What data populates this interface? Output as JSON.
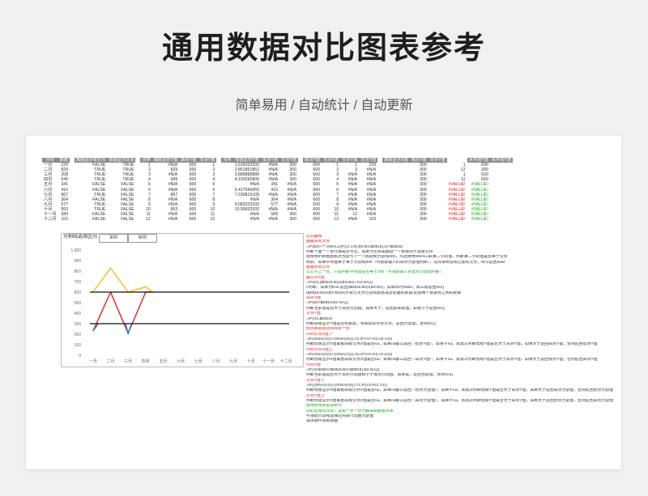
{
  "title": "通用数据对比图表参考",
  "subtitle": "简单易用 / 自动统计 / 自动更新",
  "table": {
    "headers": [
      "月份",
      "数据",
      "高级显示有交点",
      "低级显示交点",
      "点序",
      "高级显示Y值",
      "高点Y值",
      "交点Y值",
      "点序",
      "低级显示Y值",
      "低点Y值",
      "交点Y值",
      "高点Y值",
      "交点Y值",
      "交点Y值",
      "交点Y值",
      "高级显示X值",
      "高点Y值",
      "交点Y值",
      "水平线Y值",
      "水平线Y值"
    ],
    "rows": [
      [
        "一月",
        "229",
        "FALSE",
        "TRUE",
        "1",
        "#N/A",
        "600",
        "1",
        "1.618333333",
        "#N/A",
        "300",
        "600",
        "1",
        "1",
        "229",
        "300",
        "1",
        "600"
      ],
      [
        "二月",
        "829",
        "TRUE",
        "TRUE",
        "2",
        "829",
        "600",
        "2",
        "2.851851852",
        "#N/A",
        "300",
        "600",
        "2",
        "3",
        "#N/A",
        "300",
        "12",
        "300"
      ],
      [
        "三月",
        "208",
        "TRUE",
        "TRUE",
        "3",
        "#N/A",
        "600",
        "3",
        "3.888888889",
        "#N/A",
        "300",
        "600",
        "3",
        "#N/A",
        "#N/A",
        "300",
        "1",
        "600"
      ],
      [
        "四月",
        "649",
        "TRUE",
        "TRUE",
        "4",
        "649",
        "600",
        "4",
        "4.155090909",
        "#N/A",
        "300",
        "600",
        "4",
        "#N/A",
        "#N/A",
        "300",
        "12",
        "600"
      ],
      [
        "五月",
        "341",
        "FALSE",
        "FALSE",
        "5",
        "#N/A",
        "600",
        "5",
        "#N/A",
        "341",
        "#N/A",
        "600",
        "5",
        "#N/A",
        "#N/A",
        "300",
        "#VALUE!",
        "#VALUE!"
      ],
      [
        "六月",
        "410",
        "FALSE",
        "FALSE",
        "6",
        "#N/A",
        "600",
        "6",
        "6.417545455",
        "410",
        "#N/A",
        "600",
        "6",
        "#N/A",
        "#N/A",
        "300",
        "#VALUE!",
        "#VALUE!"
      ],
      [
        "七月",
        "867",
        "TRUE",
        "FALSE",
        "7",
        "867",
        "600",
        "7",
        "7.530815109",
        "#N/A",
        "#N/A",
        "600",
        "7",
        "#N/A",
        "#N/A",
        "300",
        "#VALUE!",
        "#VALUE!"
      ],
      [
        "八月",
        "364",
        "FALSE",
        "FALSE",
        "8",
        "#N/A",
        "600",
        "8",
        "#N/A",
        "364",
        "#N/A",
        "600",
        "8",
        "#N/A",
        "#N/A",
        "300",
        "#VALUE!",
        "#VALUE!"
      ],
      [
        "九月",
        "577",
        "TRUE",
        "FALSE",
        "9",
        "#N/A",
        "600",
        "9",
        "9.083333333",
        "577",
        "#N/A",
        "600",
        "9",
        "#N/A",
        "#N/A",
        "300",
        "#VALUE!",
        "#VALUE!"
      ],
      [
        "十月",
        "853",
        "TRUE",
        "FALSE",
        "10",
        "853",
        "600",
        "10",
        "10.95833333",
        "#N/A",
        "#N/A",
        "600",
        "10",
        "#N/A",
        "#N/A",
        "300",
        "#VALUE!",
        "#VALUE!"
      ],
      [
        "十一月",
        "589",
        "FALSE",
        "FALSE",
        "11",
        "#N/A",
        "600",
        "11",
        "#N/A",
        "589",
        "300",
        "600",
        "11",
        "12",
        "#N/A",
        "300",
        "#VALUE!",
        "#VALUE!"
      ],
      [
        "十二月",
        "103",
        "FALSE",
        "FALSE",
        "12",
        "#N/A",
        "600",
        "12",
        "#N/A",
        "#N/A",
        "300",
        "600",
        "12",
        "#N/A",
        "103",
        "300",
        "#VALUE!",
        "#VALUE!"
      ]
    ]
  },
  "selector": {
    "label": "分割线选择区间",
    "low": "300",
    "high": "600"
  },
  "chart_data": {
    "type": "line",
    "categories": [
      "一月",
      "二月",
      "三月",
      "四月",
      "五月",
      "六月",
      "七月",
      "八月",
      "九月",
      "十月",
      "十一月",
      "十二月"
    ],
    "yticks": [
      "1,000",
      "900",
      "800",
      "700",
      "600",
      "500",
      "400",
      "300",
      "200",
      "100",
      "0"
    ],
    "ylim": [
      0,
      1000
    ],
    "series": [
      {
        "values": [
          null,
          829,
          null,
          649,
          null,
          null,
          null,
          null,
          null,
          null,
          null,
          null
        ],
        "color": "#f2c12e"
      },
      {
        "values": [
          null,
          600,
          null,
          600,
          null,
          null,
          null,
          null,
          null,
          null,
          null,
          null
        ],
        "color": "#e03030"
      },
      {
        "values": [
          229,
          null,
          208,
          null,
          null,
          null,
          null,
          null,
          null,
          null,
          null,
          null
        ],
        "color": "#2d7dd2"
      }
    ],
    "hlines": [
      600,
      300
    ],
    "hline_color": "#111111",
    "grid": false
  },
  "notes": [
    {
      "t": "公式解释",
      "c": "r"
    },
    {
      "t": "画最高有交点",
      "c": "r"
    },
    {
      "t": "=IF(B3<+\"\",SMALL(IF((1:1:0),B2:B3,$E$16),2)+$E$16)",
      "c": ""
    },
    {
      "t": "判断下面一个单元格是否为空。如果为空就是最后一个数据则不需要交点",
      "c": ""
    },
    {
      "t": "再使用IF数组函数对当前与下一个数据和分割线600，然后使用SMALL取第二小的值，判断第二小的值是否等于交点",
      "c": ""
    },
    {
      "t": "例如：如果中间值等于等于分割线600（可根据输入的高点分割值判断），这样得到没有过度的交点，所以返回false",
      "c": ""
    },
    {
      "t": "画最低有交点",
      "c": "r"
    },
    {
      "t": "公式与上一样，只是判断中间值是否等于300（可根据输入的低点分割值判断）",
      "c": "gr"
    },
    {
      "t": "画交点X值",
      "c": "r"
    },
    {
      "t": "  =IF(D2,($E$16-B2)/(B3-B2)+G2,NA())",
      "c": ""
    },
    {
      "t": "//判断，如果为true,返回($E$16-B2)/(B3-B2)，如果D2为false，就么就返回NA()",
      "c": ""
    },
    {
      "t": "($E$16-B2)/(B3-B2)的计算方法为分割线数据减去前面的数据/前后两个数据点之间的距离",
      "c": ""
    },
    {
      "t": "高点Y值",
      "c": "r"
    },
    {
      "t": "  =IF(B2<$E$16,B2,NA())",
      "c": ""
    },
    {
      "t": "判断当前值是否大于高点分割值，如果大于，返回原来数值，如果小于返回NA()",
      "c": ""
    },
    {
      "t": "交点Y值",
      "c": "r"
    },
    {
      "t": "  =IF(H2,$E$16)",
      "c": ""
    },
    {
      "t": "判断高级显示Y值是否有数据，有数据表示有交点，返回分割值，反则NA()",
      "c": ""
    },
    {
      "t": "低点数据就比较简单一些",
      "c": "r"
    },
    {
      "t": "中间交点X值下",
      "c": "r"
    },
    {
      "t": "=IF(ISNA(V2))+(ISNA(H2)),V2,IF(V2+H2,H2,V2))",
      "c": ""
    },
    {
      "t": "判断低级显示X值或者高级交点X值是否na，如果na都么返回（低点Y值），如果不na，就再次判断低级Y值是否大于高点Y值，如果大于返回高点Y值，否则返回低点Y值",
      "c": ""
    },
    {
      "t": "中间交点X值上",
      "c": "r"
    },
    {
      "t": "  =IF(ISNA(H2))+(ISNA(V2)),H2,IF(V2+H2,V2,H2))",
      "c": ""
    },
    {
      "t": "判断低级显示X值或者高级交点X值是否na，如果na都么返回（高点Y值），如果不na，就再次判断低级Y值是否大于高点Y值，如果大于返回低点Y值，否则返回高点Y值",
      "c": ""
    },
    {
      "t": "中间Y值",
      "c": "r"
    },
    {
      "t": "  =IF(AND(B2>$E$16,B2<$D$16),B2,NA())",
      "c": ""
    },
    {
      "t": "判断当前值是否大于高点分割值和小于低点分割值，如果是，返回当前值，反则NA()",
      "c": ""
    },
    {
      "t": "交点Y值下",
      "c": "r"
    },
    {
      "t": "  =IF((ISNA(V2))+(ISNA(H2)),Y2,IF(V2>K2,Y2))",
      "c": ""
    },
    {
      "t": "判断低级显示X值或者高级交点X值是否na，如果na都么返回（低点分割值），如果不na，就再次判断低级Y值是否大于高点Y值，如果大于返回高点分割值，否则返回低点分割值",
      "c": ""
    },
    {
      "t": "交点Y值上",
      "c": "r"
    },
    {
      "t": "判断低级显示X值或者高级交点X值是否na，如果na都么返回（高点分割值），如果不na，就再次判断低级Y值是否大于高点Y值，如果大于返回低点分割值，否则返回高点分割值",
      "c": ""
    },
    {
      "t": "使用使用数据源制作",
      "c": "gr"
    },
    {
      "t": "前的逻辑比较烧，需要一步一步分解来制图看效果",
      "c": "gr"
    },
    {
      "t": "可根据分割线选择区间进行调整分割值",
      "c": ""
    },
    {
      "t": "具体操作请看动画",
      "c": ""
    }
  ]
}
